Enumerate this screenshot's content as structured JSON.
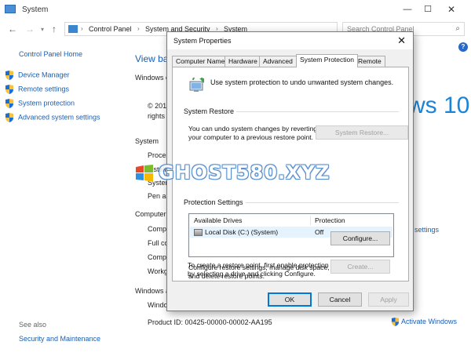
{
  "window": {
    "title": "System",
    "controls": {
      "minimize": "—",
      "maximize": "☐",
      "close": "✕"
    }
  },
  "address": {
    "breadcrumbs": [
      "Control Panel",
      "System and Security",
      "System"
    ],
    "search_placeholder": "Search Control Panel"
  },
  "left_nav": {
    "home": "Control Panel Home",
    "items": [
      "Device Manager",
      "Remote settings",
      "System protection",
      "Advanced system settings"
    ],
    "see_also": "See also",
    "see_also_items": [
      "Security and Maintenance"
    ]
  },
  "background": {
    "view_basic": "View ba",
    "windows_edition": "Windows e",
    "copyright": "© 201",
    "rights": "rights",
    "system_heading": "System",
    "processor": "Proces",
    "installed_memory": "Installe",
    "system_type": "System",
    "pen": "Pen ar",
    "computer_heading": "Computer",
    "comp1": "Comp",
    "full_name": "Full co",
    "comp2": "Comp",
    "workgroup": "Workg",
    "windows_activation": "Windows a",
    "windows_line": "Windo",
    "product_id": "Product ID:  00425-00000-00002-AA195",
    "change_settings": "Change settings",
    "windows10_logo": "ws 10",
    "activate": "Activate Windows"
  },
  "dialog": {
    "title": "System Properties",
    "close": "✕",
    "tabs": [
      "Computer Name",
      "Hardware",
      "Advanced",
      "System Protection",
      "Remote"
    ],
    "active_tab": "System Protection",
    "intro": "Use system protection to undo unwanted system changes.",
    "restore_group": "System Restore",
    "restore_text_1": "You can undo system changes by reverting",
    "restore_text_2": "your computer to a previous restore point.",
    "restore_button": "System Restore...",
    "protection_group": "Protection Settings",
    "table_headers": [
      "Available Drives",
      "Protection"
    ],
    "drives": [
      {
        "name": "Local Disk (C:) (System)",
        "protection": "Off"
      }
    ],
    "configure_text_1": "Configure restore settings, manage disk space,",
    "configure_text_2": "and delete restore points.",
    "configure_button": "Configure...",
    "create_text_1": "To create a restore point, first enable protection",
    "create_text_2": "by selecting a drive and clicking Configure.",
    "create_button": "Create...",
    "ok": "OK",
    "cancel": "Cancel",
    "apply": "Apply"
  },
  "watermark": {
    "text": "GHOST580.XYZ"
  },
  "colors": {
    "link": "#1a5fb4",
    "accent": "#0078d7",
    "win10": "#1a84d8",
    "selection": "#e5f3ff"
  }
}
